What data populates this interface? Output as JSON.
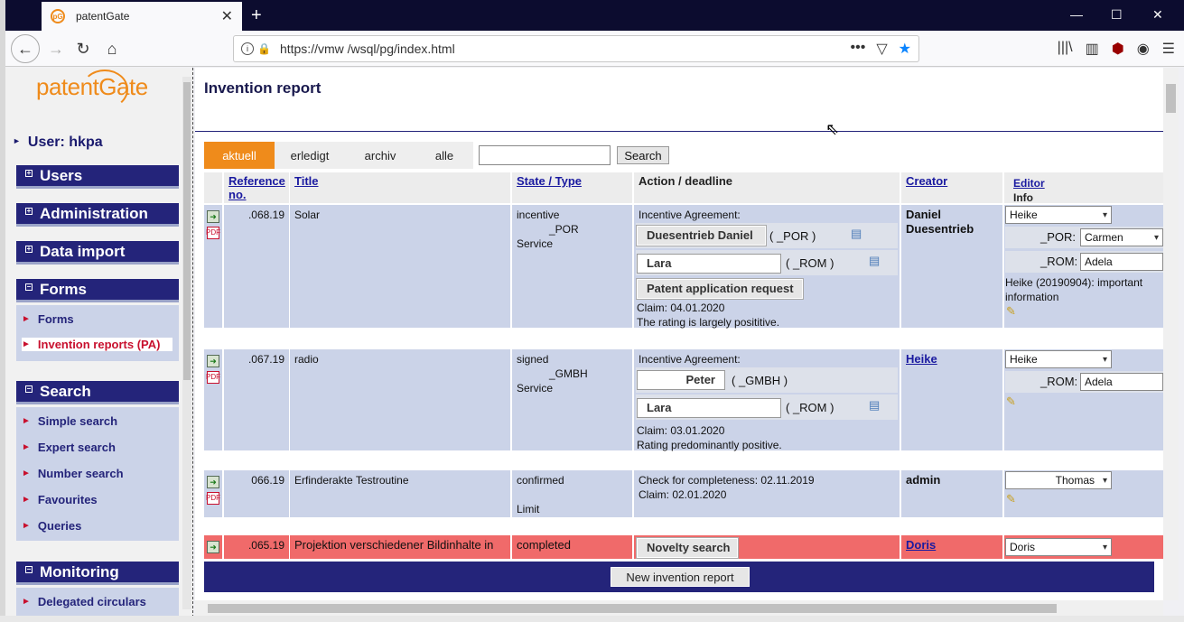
{
  "browser": {
    "tab_title": "patentGate",
    "url": "https://vmw        /wsql/pg/index.html",
    "icons": [
      "back-icon",
      "forward-icon",
      "reload-icon",
      "home-icon",
      "info-icon",
      "lock-icon",
      "more-icon",
      "pocket-icon",
      "bookmark-star-icon",
      "library-icon",
      "sidebar-icon",
      "ublock-icon",
      "account-icon",
      "menu-icon"
    ]
  },
  "sidebar": {
    "logo": "patentGate",
    "user": "User: hkpa",
    "sections": [
      {
        "title": "Users",
        "expanded": false
      },
      {
        "title": "Administration",
        "expanded": false
      },
      {
        "title": "Data import",
        "expanded": false
      },
      {
        "title": "Forms",
        "expanded": true,
        "items": [
          "Forms",
          "Invention reports (PA)"
        ],
        "active": "Invention reports (PA)"
      },
      {
        "title": "Search",
        "expanded": true,
        "items": [
          "Simple search",
          "Expert search",
          "Number search",
          "Favourites",
          "Queries"
        ]
      },
      {
        "title": "Monitoring",
        "expanded": true,
        "items": [
          "Delegated circulars"
        ]
      }
    ]
  },
  "main": {
    "title": "Invention report",
    "filter_tabs": [
      "aktuell",
      "erledigt",
      "archiv",
      "alle"
    ],
    "active_filter": "aktuell",
    "search_button": "Search",
    "search_value": "",
    "columns": [
      "Reference no.",
      "Title",
      "State / Type",
      "Action / deadline",
      "Creator",
      "Editor",
      "Info"
    ],
    "rows": [
      {
        "ref": ".068.19",
        "title": "Solar",
        "state": [
          "incentive",
          "_POR",
          "Service"
        ],
        "action_label": "Incentive Agreement:",
        "approver1": "Duesentrieb Daniel",
        "approver1_org": "( _POR )",
        "approver2": "Lara",
        "approver2_org": "( _ROM )",
        "extra_button": "Patent application request",
        "claim": "Claim: 04.01.2020",
        "note": "The rating is largely posititive.",
        "creator": "Daniel Duesentrieb",
        "editor": "Heike",
        "sub_editors": [
          {
            "label": "_POR:",
            "value": "Carmen"
          },
          {
            "label": "_ROM:",
            "value": "Adela"
          }
        ],
        "info": "Heike (20190904): important information"
      },
      {
        "ref": ".067.19",
        "title": "radio",
        "state": [
          "signed",
          "_GMBH",
          "Service"
        ],
        "action_label": "Incentive Agreement:",
        "approver1": "Peter",
        "approver1_org": "( _GMBH )",
        "approver2": "Lara",
        "approver2_org": "( _ROM )",
        "claim": "Claim: 03.01.2020",
        "note": "Rating predominantly positive.",
        "creator": "Heike",
        "editor": "Heike",
        "sub_editors": [
          {
            "label": "_ROM:",
            "value": "Adela"
          }
        ]
      },
      {
        "ref": "066.19",
        "title": "Erfinderakte Testroutine",
        "state": [
          "confirmed",
          "",
          "Limit"
        ],
        "action_label": "Check for completeness: 02.11.2019",
        "claim": "Claim: 02.01.2020",
        "creator": "admin",
        "editor": "Thomas"
      },
      {
        "ref": ".065.19",
        "title": "Projektion verschiedener Bildinhalte in",
        "state": [
          "completed"
        ],
        "action_button": "Novelty search",
        "creator": "Doris",
        "editor": "Doris"
      }
    ],
    "new_button": "New invention report"
  }
}
